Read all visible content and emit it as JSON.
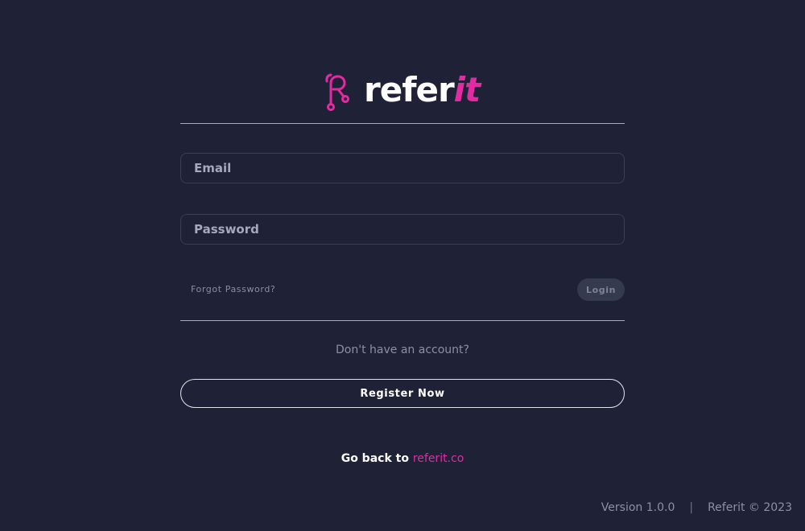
{
  "brand": {
    "name_main": "refer",
    "name_accent": "it",
    "accent_color": "#e22aa3",
    "logo_icon": "referit-logo-icon"
  },
  "form": {
    "email_placeholder": "Email",
    "password_placeholder": "Password",
    "forgot_password": "Forgot Password?",
    "login_label": "Login"
  },
  "signup": {
    "prompt": "Don't have an account?",
    "register_label": "Register Now"
  },
  "back": {
    "prefix": "Go back to ",
    "link_text": "referit.co"
  },
  "footer": {
    "version": "Version 1.0.0",
    "separator": "|",
    "copyright": "Referit © 2023"
  },
  "colors": {
    "background": "#1f2236",
    "accent": "#e22aa3"
  }
}
